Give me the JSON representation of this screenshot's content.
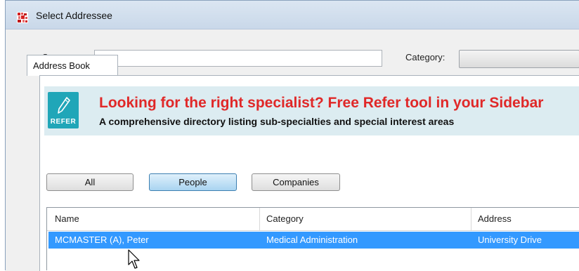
{
  "window": {
    "title": "Select Addressee"
  },
  "search": {
    "surname_label": "Surname:",
    "surname_value": "",
    "category_label": "Category:",
    "category_value": ""
  },
  "tabs": [
    {
      "label": "Address Book"
    }
  ],
  "banner": {
    "logo_text": "REFER",
    "headline": "Looking for the right specialist? Free Refer tool in your Sidebar",
    "subline": "A comprehensive directory listing sub-specialties and special interest areas",
    "headline_color": "#e02828",
    "logo_color": "#20a6b8"
  },
  "filters": {
    "all_label": "All",
    "people_label": "People",
    "companies_label": "Companies",
    "selected": "People"
  },
  "table": {
    "columns": [
      "Name",
      "Category",
      "Address"
    ],
    "rows": [
      {
        "name": "MCMASTER (A), Peter",
        "category": "Medical Administration",
        "address": "University Drive",
        "selected": true
      }
    ]
  },
  "colors": {
    "selection": "#3399ff",
    "titlebar": "#c9d8e9"
  }
}
